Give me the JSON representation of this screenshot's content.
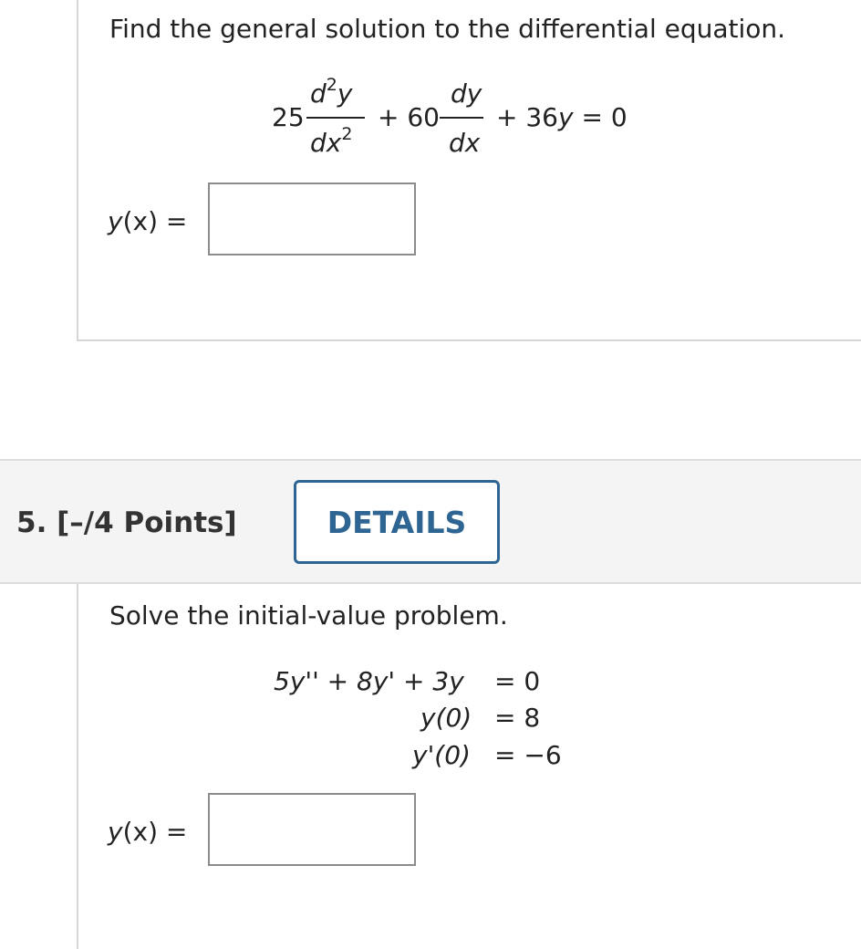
{
  "q4": {
    "prompt": "Find the general solution to the differential equation.",
    "equation": {
      "coef1": "25",
      "frac1_num_d": "d",
      "frac1_num_exp": "2",
      "frac1_num_y": "y",
      "frac1_den_dx": "dx",
      "frac1_den_exp": "2",
      "plus1": "+ 60",
      "frac2_num": "dy",
      "frac2_den": "dx",
      "tail_plus": "+ 36",
      "tail_y": "y",
      "tail_eq": "= 0"
    },
    "answer_fn": "y",
    "answer_arg": "(x) ="
  },
  "q5": {
    "number_label": "5. [–/4 Points]",
    "details_label": "DETAILS",
    "prompt": "Solve the initial-value problem.",
    "eq_lhs": "5y'' + 8y' + 3y",
    "eq_rhs": "=  0",
    "ic1_lhs": "y(0)",
    "ic1_rhs": "=  8",
    "ic2_lhs": "y'(0)",
    "ic2_rhs": "=  −6",
    "answer_fn": "y",
    "answer_arg": "(x) ="
  }
}
